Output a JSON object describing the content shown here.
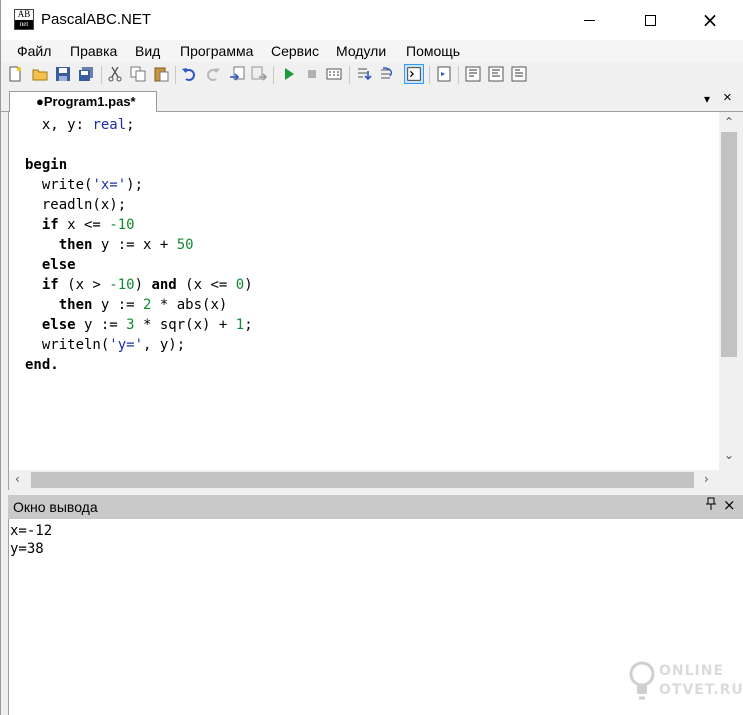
{
  "window": {
    "title": "PascalABC.NET",
    "icon_top": "AB",
    "icon_bottom": "net",
    "controls": {
      "minimize": "minimize-icon",
      "maximize": "maximize-icon",
      "close": "×"
    }
  },
  "menu": [
    "Файл",
    "Правка",
    "Вид",
    "Программа",
    "Сервис",
    "Модули",
    "Помощь"
  ],
  "toolbar": {
    "icons": [
      "new-file-icon",
      "open-file-icon",
      "save-icon",
      "save-all-icon",
      "cut-icon",
      "copy-icon",
      "paste-icon",
      "undo-icon",
      "redo-icon",
      "find-icon",
      "replace-icon",
      "run-icon",
      "stop-icon",
      "compile-icon",
      "step-into-icon",
      "step-over-icon",
      "output-window-icon",
      "form-designer-icon",
      "debug-1-icon",
      "debug-2-icon",
      "debug-3-icon"
    ]
  },
  "editor": {
    "tab_label": "●Program1.pas*",
    "tab_dropdown": "▾",
    "tab_close": "×",
    "code_lines": [
      [
        {
          "t": "  x, y: "
        },
        {
          "t": "real",
          "c": "typ"
        },
        {
          "t": ";"
        }
      ],
      [
        {
          "t": ""
        }
      ],
      [
        {
          "t": "begin",
          "c": "kw"
        }
      ],
      [
        {
          "t": "  write("
        },
        {
          "t": "'x='",
          "c": "str"
        },
        {
          "t": ");"
        }
      ],
      [
        {
          "t": "  readln(x);"
        }
      ],
      [
        {
          "t": "  "
        },
        {
          "t": "if",
          "c": "kw"
        },
        {
          "t": " x <= "
        },
        {
          "t": "-10",
          "c": "num"
        }
      ],
      [
        {
          "t": "    "
        },
        {
          "t": "then",
          "c": "kw"
        },
        {
          "t": " y := x + "
        },
        {
          "t": "50",
          "c": "num"
        }
      ],
      [
        {
          "t": "  "
        },
        {
          "t": "else",
          "c": "kw"
        }
      ],
      [
        {
          "t": "  "
        },
        {
          "t": "if",
          "c": "kw"
        },
        {
          "t": " (x > "
        },
        {
          "t": "-10",
          "c": "num"
        },
        {
          "t": ") "
        },
        {
          "t": "and",
          "c": "kw"
        },
        {
          "t": " (x <= "
        },
        {
          "t": "0",
          "c": "num"
        },
        {
          "t": ")"
        }
      ],
      [
        {
          "t": "    "
        },
        {
          "t": "then",
          "c": "kw"
        },
        {
          "t": " y := "
        },
        {
          "t": "2",
          "c": "num"
        },
        {
          "t": " * abs(x)"
        }
      ],
      [
        {
          "t": "  "
        },
        {
          "t": "else",
          "c": "kw"
        },
        {
          "t": " y := "
        },
        {
          "t": "3",
          "c": "num"
        },
        {
          "t": " * sqr(x) + "
        },
        {
          "t": "1",
          "c": "num"
        },
        {
          "t": ";"
        }
      ],
      [
        {
          "t": "  writeln("
        },
        {
          "t": "'y='",
          "c": "str"
        },
        {
          "t": ", y);"
        }
      ],
      [
        {
          "t": "end.",
          "c": "kw"
        }
      ]
    ]
  },
  "output": {
    "title": "Окно вывода",
    "pin": "📌",
    "close": "×",
    "lines": [
      "x=-12",
      "y=38"
    ]
  },
  "watermark": {
    "line1": "ONLINE",
    "line2": "OTVET.RU"
  },
  "colors": {
    "keyword": "#000000",
    "string": "#1f2ea8",
    "number": "#118a2e",
    "output_header": "#c9c9c9"
  }
}
